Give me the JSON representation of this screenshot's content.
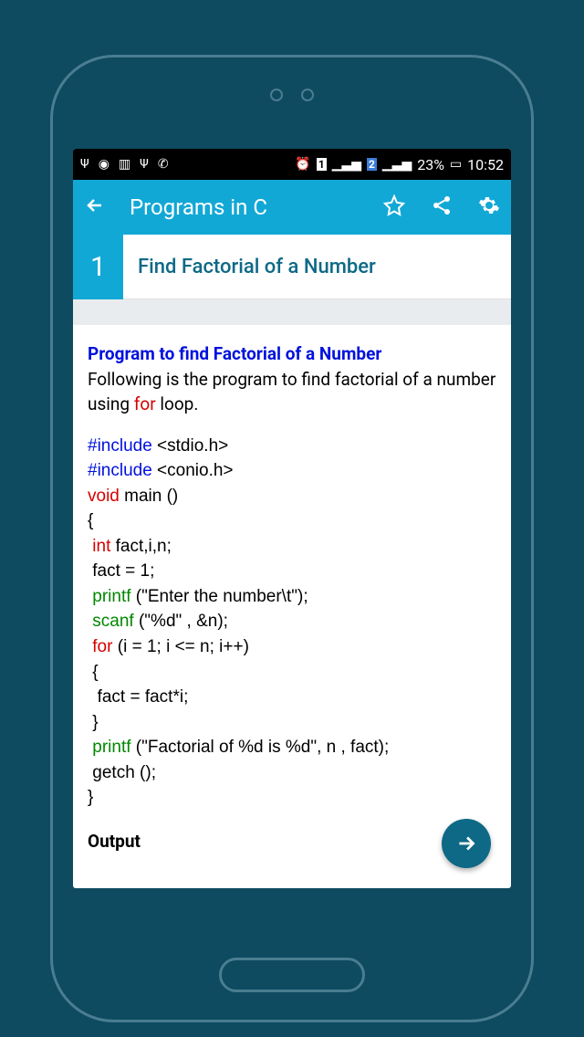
{
  "status_bar": {
    "sim1": "1",
    "sim2": "2",
    "battery": "23%",
    "time": "10:52"
  },
  "app_bar": {
    "title": "Programs in C"
  },
  "page": {
    "number": "1",
    "title": "Find Factorial of a Number"
  },
  "content": {
    "heading": "Program to find Factorial of a Number",
    "intro_pre": "Following is the program to find factorial of a number using ",
    "intro_kw": "for",
    "intro_post": " loop.",
    "code": {
      "l1_kw": "#include",
      "l1_rest": " <stdio.h>",
      "l2_kw": "#include",
      "l2_rest": " <conio.h>",
      "l3_kw": "void",
      "l3_rest": " main ()",
      "l4": "{",
      "l5_kw": "int",
      "l5_rest": " fact,i,n;",
      "l6": " fact = 1;",
      "l7_kw": "printf",
      "l7_rest": " (\"Enter the number\\t\");",
      "l8_kw": "scanf",
      "l8_rest": " (\"%d\" , &n);",
      "l9_kw": "for",
      "l9_rest": " (i = 1; i <= n; i++)",
      "l10": " {",
      "l11": "  fact = fact*i;",
      "l12": " }",
      "l13_kw": "printf",
      "l13_rest": " (\"Factorial of %d is %d\", n , fact);",
      "l14": " getch ();",
      "l15": "}"
    },
    "output_label": "Output"
  }
}
